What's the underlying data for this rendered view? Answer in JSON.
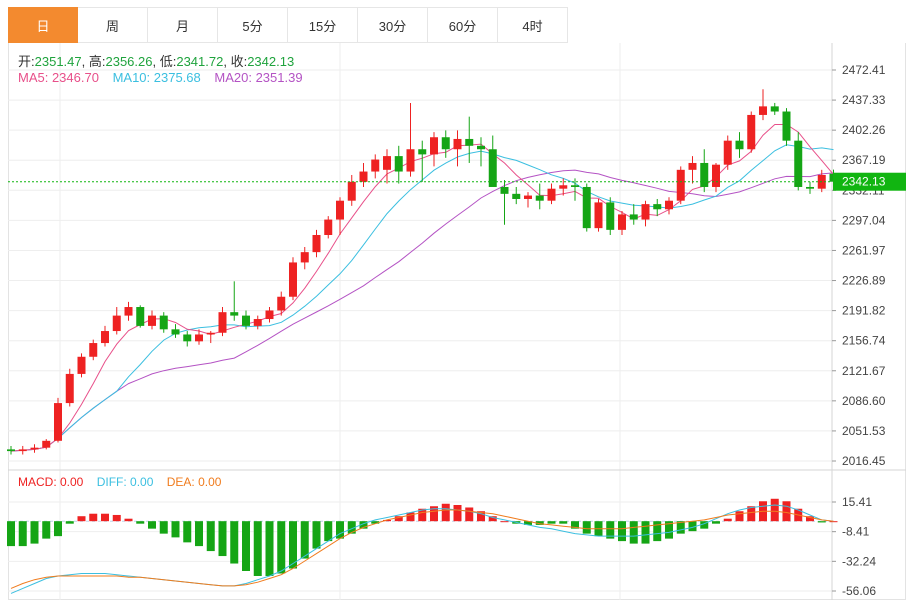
{
  "tabs": [
    "日",
    "周",
    "月",
    "5分",
    "15分",
    "30分",
    "60分",
    "4时"
  ],
  "active_tab": 0,
  "ohlc_labels": {
    "open": "开:",
    "high": "高:",
    "low": "低:",
    "close": "收:"
  },
  "ohlc_values": {
    "open": "2351.47",
    "high": "2356.26",
    "low": "2341.72",
    "close": "2342.13"
  },
  "ma_text": {
    "ma5": "MA5: 2346.70",
    "ma10": "MA10: 2375.68",
    "ma20": "MA20: 2351.39"
  },
  "macd_text": {
    "macd": "MACD: 0.00",
    "diff": "DIFF: 0.00",
    "dea": "DEA: 0.00"
  },
  "colors": {
    "up": "#ee2222",
    "down": "#15a515",
    "ma5": "#e8508a",
    "ma10": "#3bbfe0",
    "ma20": "#b453c4",
    "dea": "#f07c1e",
    "price_tag": "#11b511",
    "active_tab": "#f38a2f"
  },
  "chart_data": {
    "type": "candlestick",
    "price_axis": {
      "ticks": [
        "2472.41",
        "2437.33",
        "2402.26",
        "2367.19",
        "2332.11",
        "2297.04",
        "2261.97",
        "2226.89",
        "2191.82",
        "2156.74",
        "2121.67",
        "2086.60",
        "2051.53",
        "2016.45"
      ],
      "min": 2016.45,
      "max": 2472.41
    },
    "last_price": "2342.13",
    "candles": [
      [
        2030,
        2034,
        2024,
        2028
      ],
      [
        2028,
        2034,
        2024,
        2030
      ],
      [
        2030,
        2036,
        2026,
        2032
      ],
      [
        2032,
        2042,
        2030,
        2040
      ],
      [
        2040,
        2090,
        2038,
        2084
      ],
      [
        2084,
        2124,
        2080,
        2118
      ],
      [
        2118,
        2142,
        2114,
        2138
      ],
      [
        2138,
        2158,
        2134,
        2154
      ],
      [
        2154,
        2174,
        2150,
        2168
      ],
      [
        2168,
        2196,
        2164,
        2186
      ],
      [
        2186,
        2202,
        2180,
        2196
      ],
      [
        2196,
        2198,
        2172,
        2174
      ],
      [
        2174,
        2192,
        2170,
        2186
      ],
      [
        2186,
        2190,
        2166,
        2170
      ],
      [
        2170,
        2176,
        2160,
        2164
      ],
      [
        2164,
        2168,
        2150,
        2156
      ],
      [
        2156,
        2170,
        2152,
        2164
      ],
      [
        2164,
        2168,
        2154,
        2166
      ],
      [
        2166,
        2196,
        2162,
        2190
      ],
      [
        2190,
        2226,
        2180,
        2186
      ],
      [
        2186,
        2192,
        2170,
        2174
      ],
      [
        2174,
        2186,
        2170,
        2182
      ],
      [
        2182,
        2196,
        2178,
        2192
      ],
      [
        2192,
        2214,
        2186,
        2208
      ],
      [
        2208,
        2254,
        2204,
        2248
      ],
      [
        2248,
        2266,
        2240,
        2260
      ],
      [
        2260,
        2286,
        2254,
        2280
      ],
      [
        2280,
        2302,
        2276,
        2298
      ],
      [
        2298,
        2324,
        2280,
        2320
      ],
      [
        2320,
        2350,
        2314,
        2342
      ],
      [
        2342,
        2364,
        2336,
        2354
      ],
      [
        2354,
        2374,
        2346,
        2368
      ],
      [
        2356,
        2380,
        2340,
        2372
      ],
      [
        2372,
        2384,
        2340,
        2354
      ],
      [
        2354,
        2434,
        2348,
        2380
      ],
      [
        2380,
        2390,
        2342,
        2374
      ],
      [
        2374,
        2400,
        2360,
        2394
      ],
      [
        2394,
        2402,
        2370,
        2380
      ],
      [
        2380,
        2402,
        2360,
        2392
      ],
      [
        2392,
        2418,
        2364,
        2384
      ],
      [
        2384,
        2394,
        2360,
        2380
      ],
      [
        2380,
        2396,
        2340,
        2336
      ],
      [
        2336,
        2344,
        2292,
        2328
      ],
      [
        2328,
        2336,
        2316,
        2322
      ],
      [
        2322,
        2330,
        2312,
        2326
      ],
      [
        2326,
        2340,
        2310,
        2320
      ],
      [
        2320,
        2340,
        2316,
        2334
      ],
      [
        2334,
        2346,
        2326,
        2338
      ],
      [
        2338,
        2346,
        2320,
        2336
      ],
      [
        2336,
        2340,
        2284,
        2288
      ],
      [
        2288,
        2322,
        2284,
        2318
      ],
      [
        2318,
        2324,
        2280,
        2286
      ],
      [
        2286,
        2308,
        2280,
        2304
      ],
      [
        2304,
        2316,
        2292,
        2298
      ],
      [
        2298,
        2320,
        2290,
        2316
      ],
      [
        2316,
        2322,
        2302,
        2310
      ],
      [
        2310,
        2324,
        2304,
        2320
      ],
      [
        2320,
        2360,
        2316,
        2356
      ],
      [
        2356,
        2372,
        2340,
        2364
      ],
      [
        2364,
        2380,
        2330,
        2336
      ],
      [
        2336,
        2364,
        2330,
        2362
      ],
      [
        2362,
        2396,
        2356,
        2390
      ],
      [
        2390,
        2400,
        2370,
        2380
      ],
      [
        2380,
        2424,
        2376,
        2420
      ],
      [
        2420,
        2450,
        2414,
        2430
      ],
      [
        2430,
        2434,
        2420,
        2424
      ],
      [
        2424,
        2428,
        2384,
        2390
      ],
      [
        2390,
        2400,
        2332,
        2336
      ],
      [
        2336,
        2342,
        2328,
        2334
      ],
      [
        2334,
        2356,
        2330,
        2350
      ],
      [
        2351.47,
        2356.26,
        2341.72,
        2342.13
      ]
    ],
    "macd_axis": {
      "ticks": [
        "15.41",
        "-8.41",
        "-32.24",
        "-56.06"
      ],
      "min": -56.06,
      "max": 15.41
    },
    "macd_hist": [
      -20,
      -20,
      -18,
      -14,
      -12,
      -2,
      4,
      6,
      6,
      5,
      2,
      -2,
      -6,
      -10,
      -13,
      -17,
      -20,
      -24,
      -28,
      -34,
      -40,
      -44,
      -44,
      -42,
      -38,
      -30,
      -22,
      -16,
      -14,
      -10,
      -6,
      -2,
      1,
      4,
      7,
      10,
      12,
      14,
      13,
      11,
      8,
      4,
      0,
      -2,
      -3,
      -3,
      -2,
      -2,
      -6,
      -10,
      -12,
      -14,
      -16,
      -18,
      -18,
      -16,
      -14,
      -10,
      -8,
      -6,
      -2,
      2,
      8,
      12,
      16,
      18,
      16,
      10,
      4,
      -1,
      0
    ],
    "macd_diff": [
      -58,
      -54,
      -50,
      -46,
      -44,
      -43,
      -42,
      -42,
      -42,
      -43,
      -44,
      -45,
      -46,
      -47,
      -48,
      -49,
      -50,
      -51,
      -52,
      -52,
      -50,
      -47,
      -44,
      -40,
      -34,
      -28,
      -22,
      -16,
      -10,
      -6,
      -2,
      1,
      3,
      5,
      7,
      9,
      10,
      10,
      9,
      8,
      6,
      3,
      1,
      -1,
      -3,
      -5,
      -6,
      -8,
      -10,
      -11,
      -12,
      -12,
      -12,
      -12,
      -11,
      -10,
      -9,
      -7,
      -5,
      -2,
      2,
      6,
      9,
      11,
      12,
      13,
      12,
      9,
      5,
      1,
      0
    ],
    "macd_dea": [
      -54,
      -50,
      -47,
      -45,
      -44,
      -44,
      -44,
      -44,
      -44,
      -44,
      -45,
      -45,
      -46,
      -47,
      -48,
      -49,
      -50,
      -51,
      -52,
      -52,
      -51,
      -49,
      -46,
      -43,
      -38,
      -32,
      -26,
      -20,
      -14,
      -9,
      -5,
      -2,
      1,
      3,
      5,
      7,
      8,
      9,
      9,
      8,
      7,
      6,
      4,
      2,
      0,
      -2,
      -3,
      -4,
      -5,
      -6,
      -6,
      -6,
      -6,
      -5,
      -4,
      -3,
      -2,
      -1,
      0,
      1,
      3,
      5,
      6,
      7,
      8,
      8,
      7,
      5,
      3,
      1,
      0
    ]
  }
}
